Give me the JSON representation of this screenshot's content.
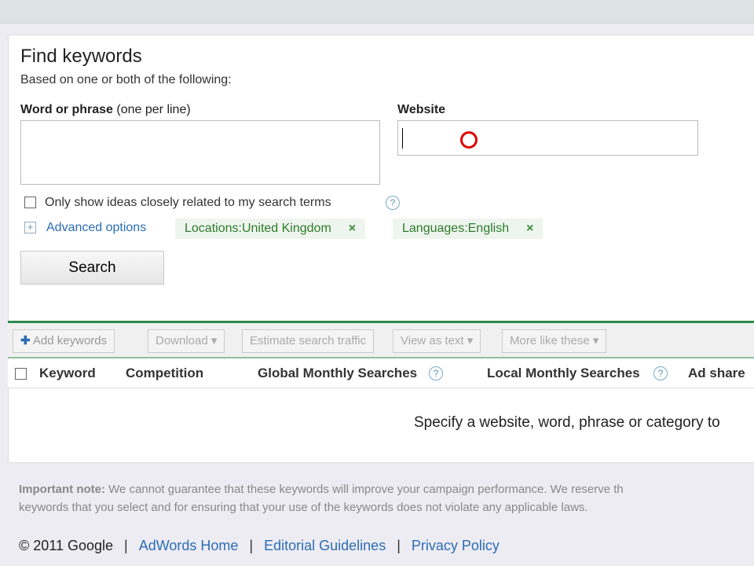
{
  "title": "Find keywords",
  "subtitle": "Based on one or both of the following:",
  "word_label": "Word or phrase",
  "word_hint": "(one per line)",
  "word_value": "",
  "website_label": "Website",
  "website_value": "",
  "only_related": "Only show ideas closely related to my search terms",
  "help": "?",
  "advanced": "Advanced options",
  "chips": [
    {
      "label": "Locations:United Kingdom",
      "x": "×"
    },
    {
      "label": "Languages:English",
      "x": "×"
    }
  ],
  "search": "Search",
  "toolbar": {
    "add": "Add keywords",
    "download": "Download ▾",
    "estimate": "Estimate search traffic",
    "view": "View as text ▾",
    "more": "More like these ▾"
  },
  "columns": [
    "Keyword",
    "Competition",
    "Global Monthly Searches",
    "Local Monthly Searches",
    "Ad share"
  ],
  "empty": "Specify a website, word, phrase or category to",
  "note_bold": "Important note:",
  "note1": " We cannot guarantee that these keywords will improve your campaign performance. We reserve th",
  "note2": "keywords that you select and for ensuring that your use of the keywords does not violate any applicable laws.",
  "footer": {
    "copy": "© 2011 Google",
    "sep": "|",
    "links": [
      "AdWords Home",
      "Editorial Guidelines",
      "Privacy Policy"
    ]
  }
}
